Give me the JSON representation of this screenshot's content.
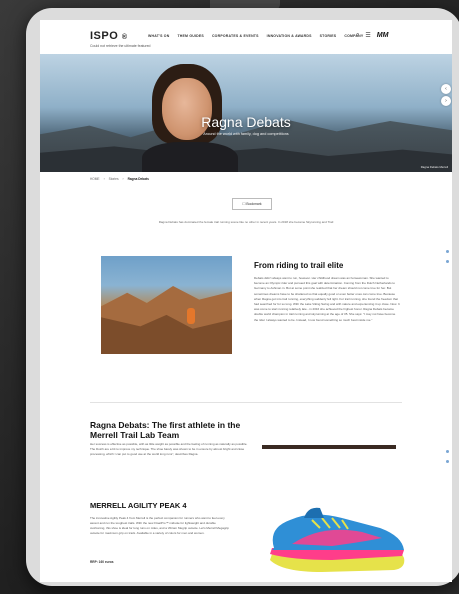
{
  "header": {
    "logo": "ISPO",
    "logo_mark": "®",
    "tagline": "Could not retrieve the ultimate featured",
    "nav": [
      "WHAT'S ON",
      "THEM GUIDES",
      "CORPORATES & EVENTS",
      "INNOVATION & AWARDS",
      "STORIES",
      "COMPANY"
    ],
    "icons": {
      "search": "search-icon",
      "user": "user-icon"
    },
    "partner_logo": "MM"
  },
  "hero": {
    "title": "Ragna Debats",
    "subtitle": "Around the world with family, dog and competitions",
    "credit": "Ragna Debats Merrell"
  },
  "breadcrumb": [
    "HOME",
    "Stories",
    "Ragna Debats"
  ],
  "share_label": "Bookmark",
  "intro": "Ragna Debats has dominated the female trail running scene like no other in recent years. In 2018 she became Skyrunning and Trail",
  "section1": {
    "heading": "From riding to trail elite",
    "body": "Debats didn't always want to run, however. Her childhood dream was an horsewoman. She wanted to become an Olympic rider and pursued this goal with determination. Coming from the Dutch Netherlands to Germany to Ashman in. But at some point she realized that her dream should not come true for her. But sometimes dreams have to be shattered so that equally good or even better ones can come true. Because when Ragna got into trail running, everything suddenly fell right. For trail running, she found the freedom that had searched for for so long. With the Lake Viking Swing and with nature and experiencing it up close. Now. It was come to start running relatively late - in 2016 she achieved the highest honor. Ragna Debats became double world champion in trail running and skyrunning at the age of 35. She says: \"I may not have become the rider I always wanted to be. Instead, I now found something so much best inside me.\""
  },
  "section2": {
    "heading": "Ragna Debats: The first athlete in the Merrell Trail Lab Team",
    "body": "Her success is effective as possible, with as little weight as possible and the feeling of running as naturally as possible. The Dutch are a bit to improve my technique. The shoe barely was shown to be in ensure by almost bright and close processing, which I can put to good use at the world long runs\", describes Ragna."
  },
  "section3": {
    "heading": "MERRELL AGILITY PEAK 4",
    "body": "The innovative Agility Peak 4 from Merrell is the perfect companion for runners who want to feel every ascent and run the toughest trails. With the new FloatPro™ midsole for lightweight and durable cushioning, this shoe is ideal for long runs on miles, and a Vibram Megrip outsole. Let's Merrell Megagrip outsole for maximum grip on track. Available in a variety of colors for men and women.",
    "price": "RRP: 160 euros"
  },
  "side_controls": [
    "‹",
    "›"
  ],
  "colors": {
    "shoe_upper": "#2f8fd6",
    "shoe_accent": "#ff3d8a",
    "shoe_sole": "#e6e24a",
    "hero_sky": "#bdd3e3"
  }
}
